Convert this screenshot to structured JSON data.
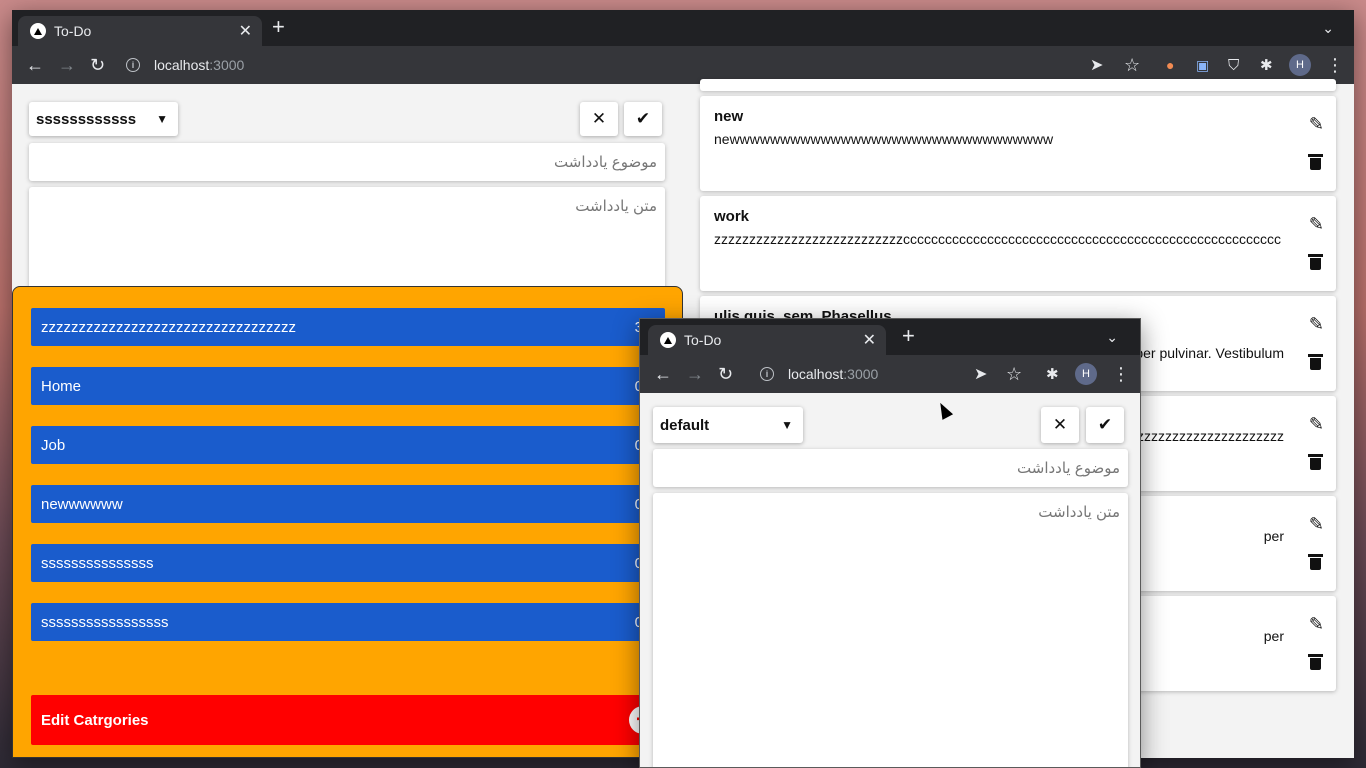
{
  "main_window": {
    "tab_title": "To-Do",
    "url_host": "localhost",
    "url_port": ":3000",
    "avatar": "H"
  },
  "form": {
    "category_selected": "ssssssssssss",
    "title_placeholder": "موضوع یادداشت",
    "body_placeholder": "متن یادداشت"
  },
  "notes": [
    {
      "title": "new",
      "body": "newwwwwwwwwwwwwwwwwwwwwwwwwwwwwwww"
    },
    {
      "title": "work",
      "body": "zzzzzzzzzzzzzzzzzzzzzzzzzzzcccccccccccccccccccccccccccccccccccccccccccccccccccccc"
    },
    {
      "title": "ulis quis, sem. Phasellus",
      "body": "per pulvinar. Vestibulum"
    },
    {
      "title": "",
      "body": "zzzzzzzzzzzzzzzzzzzzzzzzzzzz"
    },
    {
      "title": "",
      "body": "per"
    },
    {
      "title": "",
      "body": "per"
    }
  ],
  "categories": [
    {
      "name": "zzzzzzzzzzzzzzzzzzzzzzzzzzzzzzzzzz",
      "count": "3"
    },
    {
      "name": "Home",
      "count": "0"
    },
    {
      "name": "Job",
      "count": "0"
    },
    {
      "name": "newwwwww",
      "count": "0"
    },
    {
      "name": "sssssssssssssss",
      "count": "0"
    },
    {
      "name": "sssssssssssssssss",
      "count": "0"
    }
  ],
  "edit_categories_label": "Edit Catrgories",
  "popup_window": {
    "tab_title": "To-Do",
    "url_host": "localhost",
    "url_port": ":3000",
    "avatar": "H",
    "category_selected": "default",
    "title_placeholder": "موضوع یادداشت",
    "body_placeholder": "متن یادداشت"
  },
  "icons": {
    "close": "close-icon",
    "check": "check-icon",
    "edit": "pencil-icon",
    "delete": "trash-icon"
  },
  "colors": {
    "panel": "#ffa500",
    "category": "#1a5ccc",
    "edit_categories": "#ff0000",
    "browser_dark": "#202124",
    "browser_toolbar": "#35363a"
  }
}
